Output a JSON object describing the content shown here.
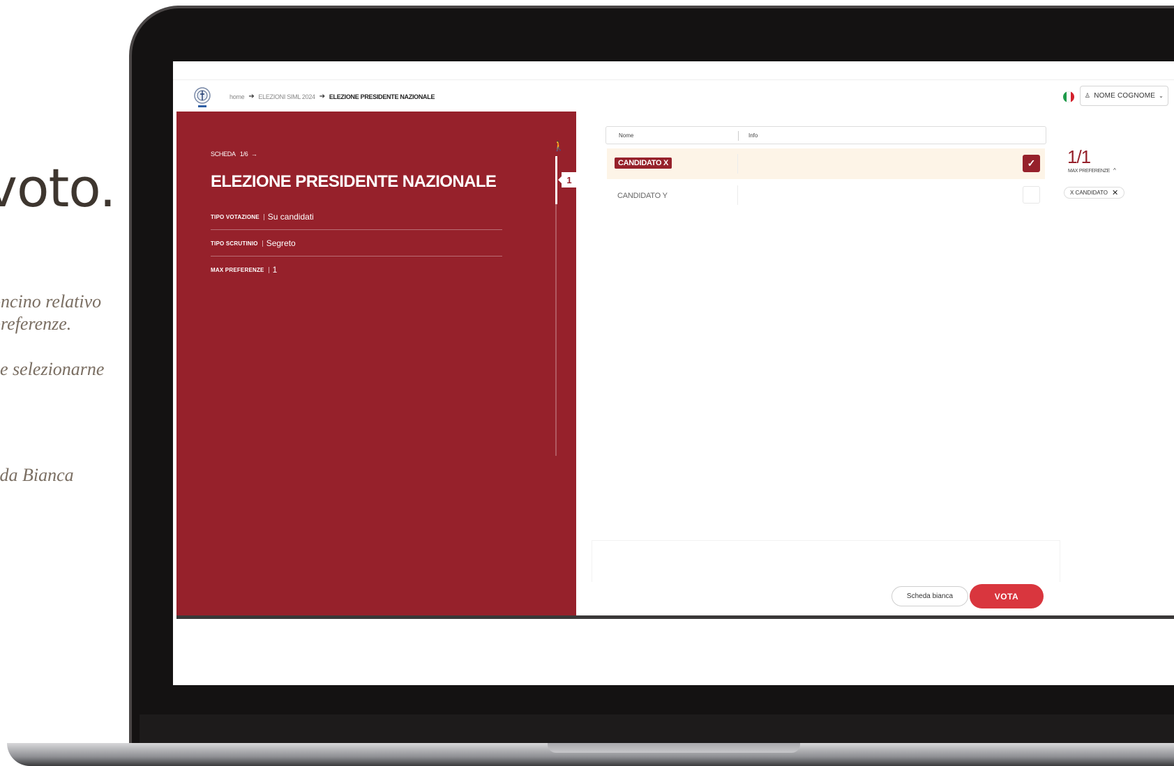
{
  "slide": {
    "title": "voto.",
    "lines": [
      "oncino relativo",
      "preferenze.",
      "e selezionarne",
      "eda Bianca"
    ]
  },
  "topbar": {
    "breadcrumb": [
      "home",
      "ELEZIONI SIML 2024",
      "ELEZIONE PRESIDENTE NAZIONALE"
    ],
    "user_label": "NOME COGNOME",
    "flag_colors": [
      "#1e9a4a",
      "#ffffff",
      "#d3212c"
    ]
  },
  "ballot": {
    "scheda_label": "SCHEDA",
    "scheda_index": "1/6",
    "title": "ELEZIONE PRESIDENTE NAZIONALE",
    "fields": [
      {
        "label": "TIPO VOTAZIONE",
        "value": "Su candidati"
      },
      {
        "label": "TIPO SCRUTINIO",
        "value": "Segreto"
      },
      {
        "label": "MAX PREFERENZE",
        "value": "1"
      }
    ],
    "step": "1",
    "progress": 0.16
  },
  "table": {
    "headers": {
      "name": "Nome",
      "info": "Info"
    },
    "candidates": [
      {
        "name": "CANDIDATO X",
        "selected": true
      },
      {
        "name": "CANDIDATO Y",
        "selected": false
      }
    ]
  },
  "preferences": {
    "count": "1/1",
    "label": "MAX PREFERENZE",
    "chip": "X CANDIDATO"
  },
  "actions": {
    "blank_label": "Scheda bianca",
    "vote_label": "VOTA"
  },
  "colors": {
    "accent": "#96212b",
    "vote": "#d9363e",
    "selected_row": "#fdf4e7"
  }
}
